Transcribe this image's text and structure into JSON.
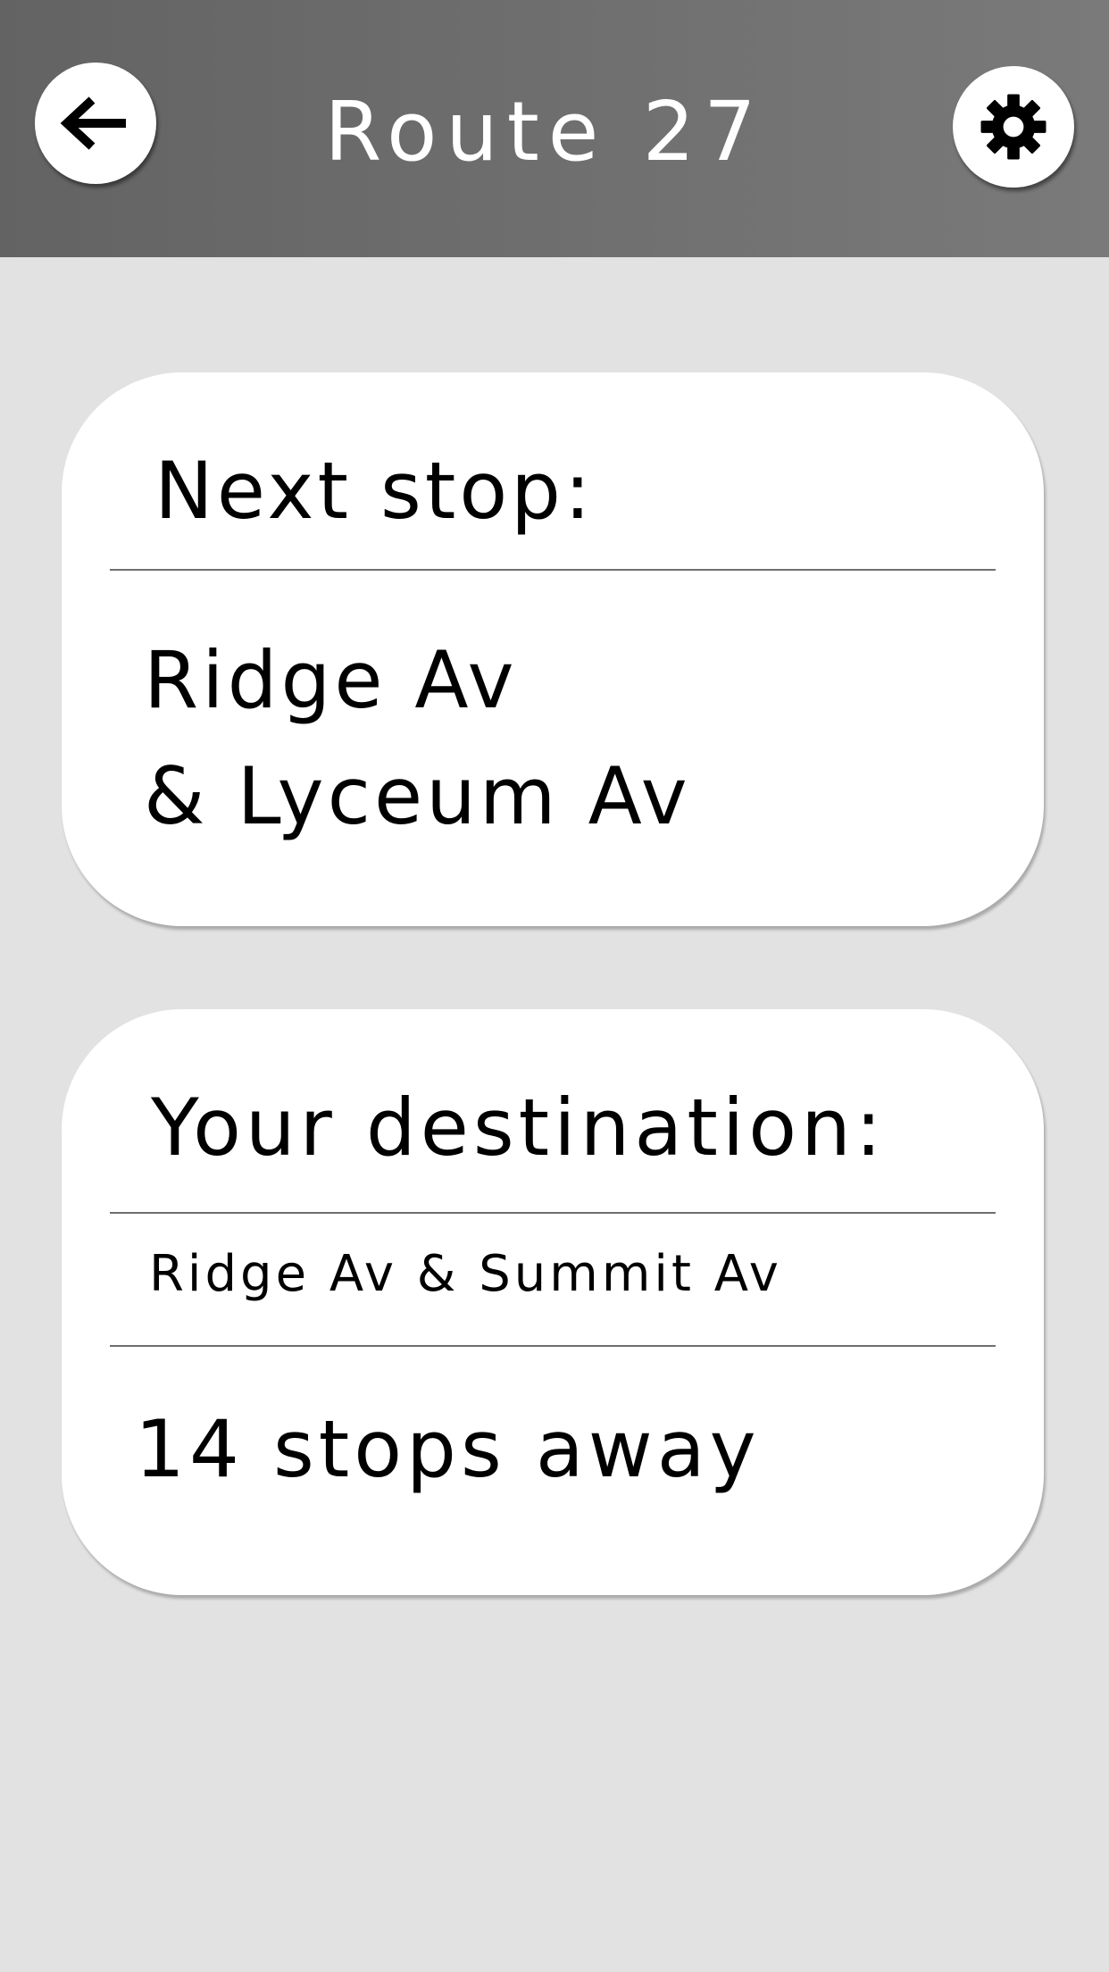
{
  "header": {
    "title": "Route 27",
    "back_icon": "arrow-left-icon",
    "settings_icon": "gear-icon"
  },
  "next_stop": {
    "label": "Next stop:",
    "line1": "Ridge Av",
    "line2": "& Lyceum Av"
  },
  "destination": {
    "label": "Your destination:",
    "name": "Ridge Av & Summit Av",
    "stops_away": "14 stops away"
  },
  "colors": {
    "header_background": "#6e6e6e",
    "page_background": "#e2e2e2",
    "card_background": "#ffffff",
    "title_text": "#ffffff"
  }
}
